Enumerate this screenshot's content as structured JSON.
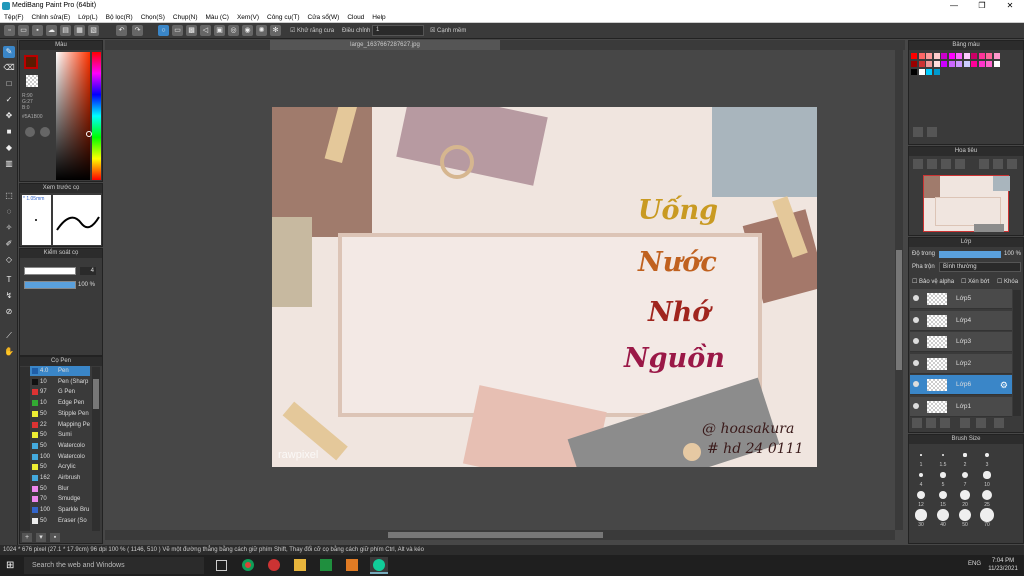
{
  "window": {
    "title": "MediBang Paint Pro (64bit)",
    "minimize": "—",
    "maximize": "❐",
    "close": "✕"
  },
  "menu": [
    "Tệp(F)",
    "Chỉnh sửa(E)",
    "Lớp(L)",
    "Bộ lọc(R)",
    "Chọn(S)",
    "Chụp(N)",
    "Màu (C)",
    "Xem(V)",
    "Công cụ(T)",
    "Cửa sổ(W)",
    "Cloud",
    "Help"
  ],
  "toolbar": {
    "antialias_label": "Khử răng cưa",
    "adjust_label": "Điều chỉnh",
    "adjust_value": "1",
    "snap_label": "Cạnh mềm"
  },
  "color_panel": {
    "title": "Màu",
    "r": "R:90",
    "g": "G:27",
    "b": "B:0",
    "hex": "#5A1B00"
  },
  "brush_preview": {
    "title": "Xem trước cọ",
    "size": "* 1.05mm"
  },
  "brush_control": {
    "title": "Kiểm soát cọ",
    "size_value": "4",
    "opacity_value": "100 %"
  },
  "brushes": {
    "title": "Cọ Pen",
    "items": [
      {
        "size": "4.0",
        "name": "Pen",
        "color": "#1f5ea8"
      },
      {
        "size": "10",
        "name": "Pen (Sharp",
        "color": "#111111"
      },
      {
        "size": "97",
        "name": "G Pen",
        "color": "#d33"
      },
      {
        "size": "10",
        "name": "Edge Pen",
        "color": "#3a3"
      },
      {
        "size": "50",
        "name": "Stipple Pen",
        "color": "#ee3"
      },
      {
        "size": "22",
        "name": "Mapping Pe",
        "color": "#d33"
      },
      {
        "size": "50",
        "name": "Sumi",
        "color": "#ee3"
      },
      {
        "size": "50",
        "name": "Watercolo",
        "color": "#4ad"
      },
      {
        "size": "100",
        "name": "Watercolo",
        "color": "#4ad"
      },
      {
        "size": "50",
        "name": "Acrylic",
        "color": "#ee3"
      },
      {
        "size": "162",
        "name": "Airbrush",
        "color": "#4ad"
      },
      {
        "size": "50",
        "name": "Blur",
        "color": "#e8e"
      },
      {
        "size": "70",
        "name": "Smudge",
        "color": "#e8e"
      },
      {
        "size": "100",
        "name": "Sparkle Bru",
        "color": "#36c"
      },
      {
        "size": "50",
        "name": "Eraser (So",
        "color": "#eee"
      }
    ]
  },
  "document": {
    "tab": "large_1637667287627.jpg"
  },
  "artwork": {
    "line1": "Uống",
    "line2": "Nước",
    "line3": "Nhớ",
    "line4": "Nguồn",
    "sig1": "@ hoasakura",
    "sig2": "# hd 24 0111",
    "watermark": "rawpixel"
  },
  "palette": {
    "title": "Bảng màu"
  },
  "navigator": {
    "title": "Hoa tiêu"
  },
  "layers": {
    "title": "Lớp",
    "opacity_label": "Độ trong",
    "opacity_value": "100 %",
    "blend_label": "Pha trộn",
    "blend_value": "Bình thường",
    "protect_alpha": "Bảo vệ alpha",
    "clipping": "Xén bớt",
    "lock": "Khóa",
    "items": [
      {
        "name": "Lớp5",
        "selected": false
      },
      {
        "name": "Lớp4",
        "selected": false
      },
      {
        "name": "Lớp3",
        "selected": false
      },
      {
        "name": "Lớp2",
        "selected": false
      },
      {
        "name": "Lớp6",
        "selected": true
      },
      {
        "name": "Lớp1",
        "selected": false
      }
    ]
  },
  "brush_size": {
    "title": "Brush Size",
    "labels": [
      "1",
      "1.5",
      "2",
      "3",
      "4",
      "5",
      "7",
      "10",
      "12",
      "15",
      "20",
      "25",
      "30",
      "40",
      "50",
      "70"
    ]
  },
  "status": "1024 * 676 pixel  (27.1 * 17.9cm)  96 dpi  100 %  ( 1146, 510 )  Vẽ một đường thẳng bằng cách giữ phím Shift, Thay đổi cỡ cọ bằng cách giữ phím Ctrl, Alt và kéo",
  "taskbar": {
    "search": "Search the web and Windows",
    "time": "7:04 PM",
    "date": "11/23/2021",
    "lang": "ENG"
  }
}
